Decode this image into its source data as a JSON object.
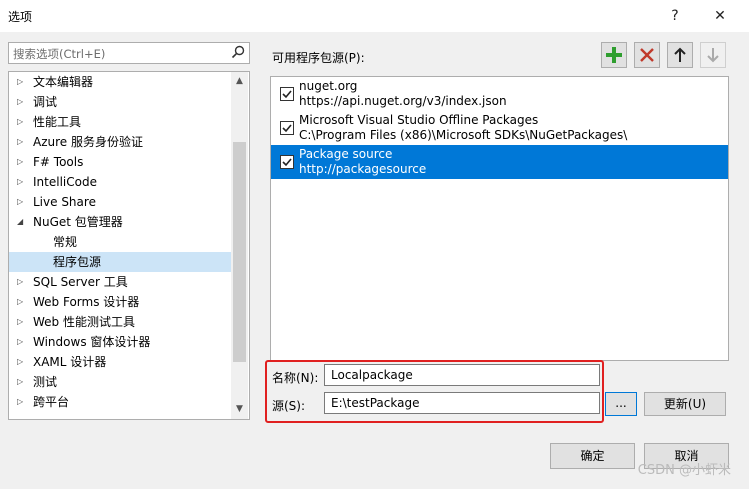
{
  "window": {
    "title": "选项",
    "help_label": "?",
    "close_label": "✕"
  },
  "search": {
    "placeholder": "搜索选项(Ctrl+E)"
  },
  "tree": {
    "items": [
      {
        "label": "文本编辑器",
        "arrow": "▷"
      },
      {
        "label": "调试",
        "arrow": "▷"
      },
      {
        "label": "性能工具",
        "arrow": "▷"
      },
      {
        "label": "Azure 服务身份验证",
        "arrow": "▷"
      },
      {
        "label": "F# Tools",
        "arrow": "▷"
      },
      {
        "label": "IntelliCode",
        "arrow": "▷"
      },
      {
        "label": "Live Share",
        "arrow": "▷"
      },
      {
        "label": "NuGet 包管理器",
        "arrow": "◢"
      },
      {
        "label": "常规",
        "arrow": ""
      },
      {
        "label": "程序包源",
        "arrow": ""
      },
      {
        "label": "SQL Server 工具",
        "arrow": "▷"
      },
      {
        "label": "Web Forms 设计器",
        "arrow": "▷"
      },
      {
        "label": "Web 性能测试工具",
        "arrow": "▷"
      },
      {
        "label": "Windows 窗体设计器",
        "arrow": "▷"
      },
      {
        "label": "XAML 设计器",
        "arrow": "▷"
      },
      {
        "label": "测试",
        "arrow": "▷"
      },
      {
        "label": "跨平台",
        "arrow": "▷"
      }
    ]
  },
  "sources_panel": {
    "label": "可用程序包源(P):",
    "toolbar": {
      "add_icon": "plus-icon",
      "remove_icon": "delete-icon",
      "up_icon": "arrow-up-icon",
      "down_icon": "arrow-down-icon"
    },
    "sources": [
      {
        "name": "nuget.org",
        "url": "https://api.nuget.org/v3/index.json",
        "checked": true,
        "selected": false
      },
      {
        "name": "Microsoft Visual Studio Offline Packages",
        "url": "C:\\Program Files (x86)\\Microsoft SDKs\\NuGetPackages\\",
        "checked": true,
        "selected": false
      },
      {
        "name": "Package source",
        "url": "http://packagesource",
        "checked": true,
        "selected": true
      }
    ]
  },
  "form": {
    "name_label": "名称(N):",
    "name_value": "Localpackage",
    "source_label": "源(S):",
    "source_value": "E:\\testPackage",
    "browse_label": "...",
    "update_label": "更新(U)"
  },
  "footer": {
    "ok_label": "确定",
    "cancel_label": "取消"
  },
  "watermark": "CSDN @小虾米",
  "colors": {
    "selection": "#0078d7",
    "tree_selection": "#cce4f7",
    "highlight_border": "#e02020",
    "add_green": "#2f9e2f",
    "remove_red": "#c0392b"
  }
}
